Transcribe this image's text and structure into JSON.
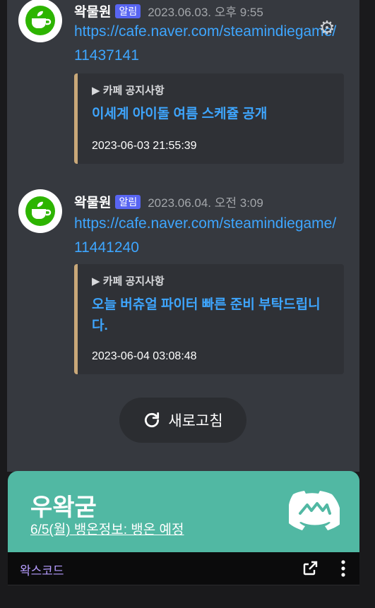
{
  "messages": [
    {
      "author": "왁물원",
      "badge": "알림",
      "time": "2023.06.03. 오후 9:55",
      "link": "https://cafe.naver.com/steamindiegame/11437141",
      "embed": {
        "notice": "▶ 카페 공지사항",
        "title": "이세계 아이돌 여름 스케쥴 공개",
        "footer": "2023-06-03 21:55:39"
      }
    },
    {
      "author": "왁물원",
      "badge": "알림",
      "time": "2023.06.04. 오전 3:09",
      "link": "https://cafe.naver.com/steamindiegame/11441240",
      "embed": {
        "notice": "▶ 카페 공지사항",
        "title": "오늘 버츄얼 파이터 빠른 준비 부탁드립니다.",
        "footer": "2023-06-04 03:08:48"
      }
    }
  ],
  "refresh_label": "새로고침",
  "banner": {
    "server_name": "우왁굳",
    "subtitle": "6/5(월) 뱅온정보: 뱅온 예정"
  },
  "footer": {
    "label": "왁스코드"
  },
  "colors": {
    "accent_link": "#3ea6ff",
    "badge": "#5865f2",
    "embed_bar": "#c9a879",
    "banner": "#51b8a3"
  },
  "icons": [
    "naver-cafe-cup-icon",
    "gear-icon",
    "refresh-icon",
    "discord-logo-icon",
    "external-link-icon",
    "more-vertical-icon"
  ]
}
